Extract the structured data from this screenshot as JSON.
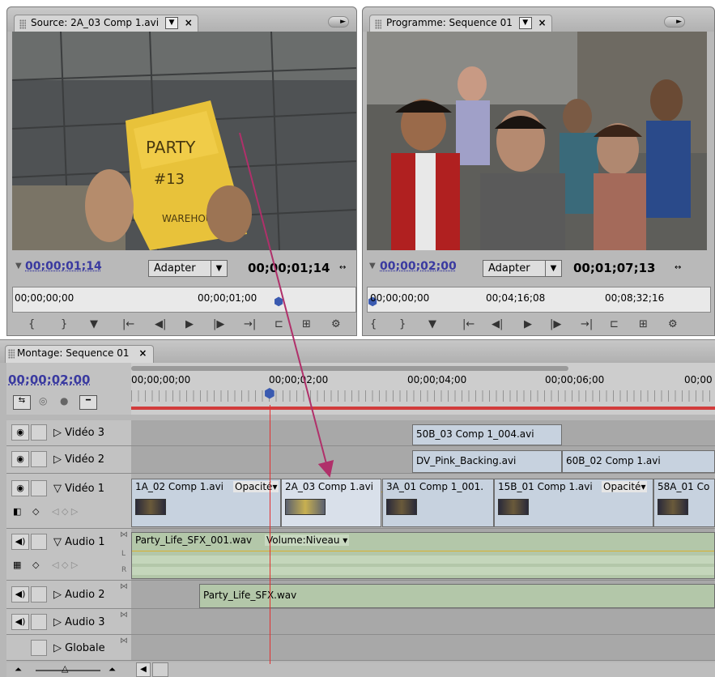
{
  "source": {
    "tab_label": "Source: 2A_03 Comp 1.avi",
    "timecode_current": "00;00;01;14",
    "fit_label": "Adapter",
    "timecode_duration": "00;00;01;14",
    "ruler_start": "00;00;00;00",
    "ruler_mid": "00;00;01;00"
  },
  "program": {
    "tab_label": "Programme: Sequence 01",
    "timecode_current": "00;00;02;00",
    "fit_label": "Adapter",
    "timecode_duration": "00;01;07;13",
    "ruler_start": "00;00;00;00",
    "ruler_mid": "00;04;16;08",
    "ruler_end": "00;08;32;16"
  },
  "timeline": {
    "tab_label": "Montage: Sequence 01",
    "timecode": "00;00;02;00",
    "ruler_labels": [
      "00;00;00;00",
      "00;00;02;00",
      "00;00;04;00",
      "00;00;06;00",
      "00;00"
    ],
    "tracks": {
      "video3": "Vidéo 3",
      "video2": "Vidéo 2",
      "video1": "Vidéo 1",
      "audio1": "Audio 1",
      "audio2": "Audio 2",
      "audio3": "Audio 3",
      "master": "Globale"
    },
    "clips": {
      "v3_a": "50B_03 Comp 1_004.avi",
      "v2_a": "DV_Pink_Backing.avi",
      "v2_b": "60B_02 Comp 1.avi",
      "v1_a": "1A_02 Comp 1.avi",
      "v1_a_fx": "Opacité",
      "v1_b": "2A_03 Comp 1.avi",
      "v1_c": "3A_01 Comp 1_001.",
      "v1_d": "15B_01 Comp 1.avi",
      "v1_d_fx": "Opacité",
      "v1_e": "58A_01 Co",
      "a1_a": "Party_Life_SFX_001.wav",
      "a1_fx": "Volume:Niveau",
      "a2_a": "Party_Life_SFX.wav"
    }
  },
  "colors": {
    "timecode_blue": "#3a3aa0",
    "playhead_red": "#e23030",
    "arrow": "#b0306a"
  }
}
